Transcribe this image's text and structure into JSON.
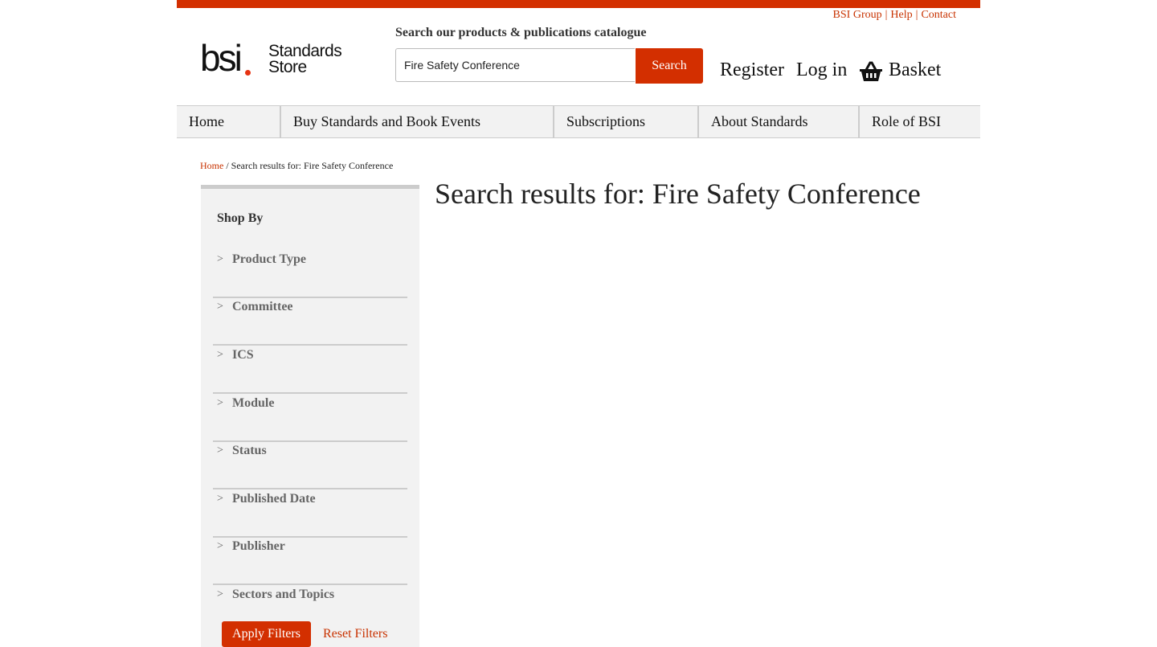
{
  "colors": {
    "accent": "#d32f00",
    "nav_bg": "#f2f2f2",
    "sidebar_bg": "#f2f2f2"
  },
  "util_links": [
    "BSI Group",
    "Help",
    "Contact"
  ],
  "logo": {
    "brand": "bsi",
    "line1": "Standards",
    "line2": "Store"
  },
  "search": {
    "title": "Search our products & publications catalogue",
    "value": "Fire Safety Conference",
    "button": "Search"
  },
  "account": {
    "register": "Register",
    "login": "Log in",
    "basket": "Basket",
    "basket_icon": "basket-icon"
  },
  "nav": [
    "Home",
    "Buy Standards and Book Events",
    "Subscriptions",
    "About Standards",
    "Role of BSI"
  ],
  "breadcrumb": {
    "home": "Home",
    "separator": "/",
    "current": "Search results for: Fire Safety Conference"
  },
  "sidebar": {
    "title": "Shop By",
    "chevron": ">",
    "facets": [
      "Product Type",
      "Committee",
      "ICS",
      "Module",
      "Status",
      "Published Date",
      "Publisher",
      "Sectors and Topics"
    ],
    "apply": "Apply Filters",
    "reset": "Reset Filters"
  },
  "main": {
    "title": "Search results for: Fire Safety Conference"
  }
}
